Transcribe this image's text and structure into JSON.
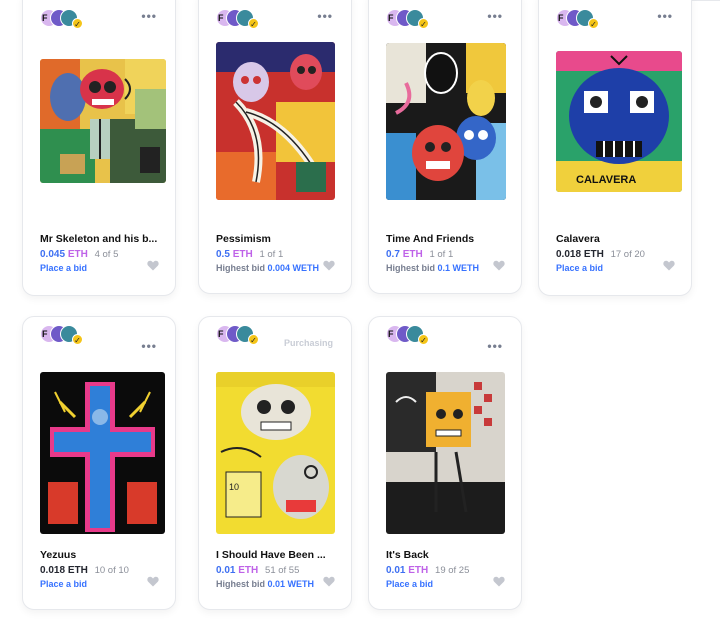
{
  "cards": [
    {
      "creator_initial": "F",
      "verified_icon": "check-badge-icon",
      "menu": "•••",
      "title": "Mr Skeleton and his b...",
      "price": "0.045",
      "currency": "ETH",
      "edition": "4 of 5",
      "bid_link": "Place a bid",
      "status": ""
    },
    {
      "creator_initial": "F",
      "verified_icon": "check-badge-icon",
      "menu": "•••",
      "title": "Pessimism",
      "price": "0.5",
      "currency": "ETH",
      "edition": "1 of 1",
      "bid_label": "Highest bid",
      "bid_value": "0.004 WETH",
      "status": ""
    },
    {
      "creator_initial": "F",
      "verified_icon": "check-badge-icon",
      "menu": "•••",
      "title": "Time And Friends",
      "price": "0.7",
      "currency": "ETH",
      "edition": "1 of 1",
      "bid_label": "Highest bid",
      "bid_value": "0.1 WETH",
      "status": ""
    },
    {
      "creator_initial": "F",
      "verified_icon": "check-badge-icon",
      "menu": "•••",
      "title": "Calavera",
      "price": "0.018",
      "currency": "ETH",
      "edition": "17 of 20",
      "bid_link": "Place a bid",
      "status": ""
    },
    {
      "creator_initial": "F",
      "verified_icon": "check-badge-icon",
      "menu": "•••",
      "title": "Yezuus",
      "price": "0.018",
      "currency": "ETH",
      "edition": "10 of 10",
      "bid_link": "Place a bid",
      "status": ""
    },
    {
      "creator_initial": "F",
      "verified_icon": "check-badge-icon",
      "menu": "",
      "title": "I Should Have Been ...",
      "price": "0.01",
      "currency": "ETH",
      "edition": "51 of 55",
      "bid_label": "Highest bid",
      "bid_value": "0.01 WETH",
      "status": "Purchasing"
    },
    {
      "creator_initial": "F",
      "verified_icon": "check-badge-icon",
      "menu": "•••",
      "title": "It's Back",
      "price": "0.01",
      "currency": "ETH",
      "edition": "19 of 25",
      "bid_link": "Place a bid",
      "status": ""
    }
  ],
  "colors": {
    "accent_blue": "#3772ff",
    "eth_purple": "#bf63e8",
    "muted": "#777e90",
    "border": "#e6e8ec"
  }
}
